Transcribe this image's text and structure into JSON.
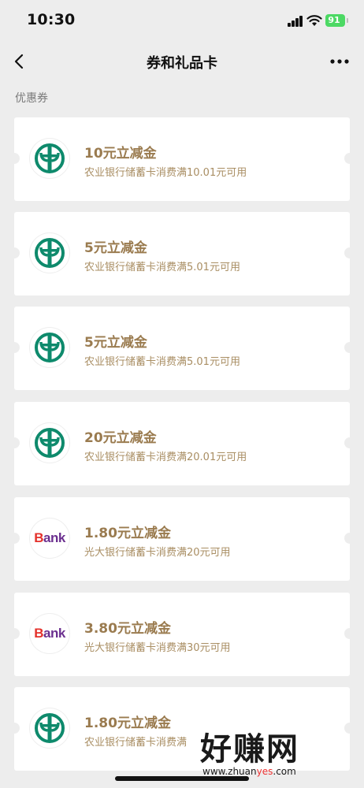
{
  "status_bar": {
    "time": "10:30",
    "battery": "91"
  },
  "nav": {
    "title": "券和礼品卡"
  },
  "section": {
    "label": "优惠券"
  },
  "coupons": [
    {
      "title": "10元立减金",
      "desc": "农业银行储蓄卡消费满10.01元可用",
      "bank": "abc"
    },
    {
      "title": "5元立减金",
      "desc": "农业银行储蓄卡消费满5.01元可用",
      "bank": "abc"
    },
    {
      "title": "5元立减金",
      "desc": "农业银行储蓄卡消费满5.01元可用",
      "bank": "abc"
    },
    {
      "title": "20元立减金",
      "desc": "农业银行储蓄卡消费满20.01元可用",
      "bank": "abc"
    },
    {
      "title": "1.80元立减金",
      "desc": "光大银行储蓄卡消费满20元可用",
      "bank": "ebank",
      "logo_text": "Bank"
    },
    {
      "title": "3.80元立减金",
      "desc": "光大银行储蓄卡消费满30元可用",
      "bank": "ebank",
      "logo_text": "Bank"
    },
    {
      "title": "1.80元立减金",
      "desc": "农业银行储蓄卡消费满",
      "bank": "abc"
    }
  ],
  "watermark": {
    "main": "好赚网",
    "url_prefix": "www.zhuan",
    "url_highlight": "yes",
    "url_suffix": ".com"
  },
  "colors": {
    "background": "#ededed",
    "coupon_title": "#9a7b4f",
    "abc_green": "#0e8a6c",
    "battery": "#4cd964"
  }
}
